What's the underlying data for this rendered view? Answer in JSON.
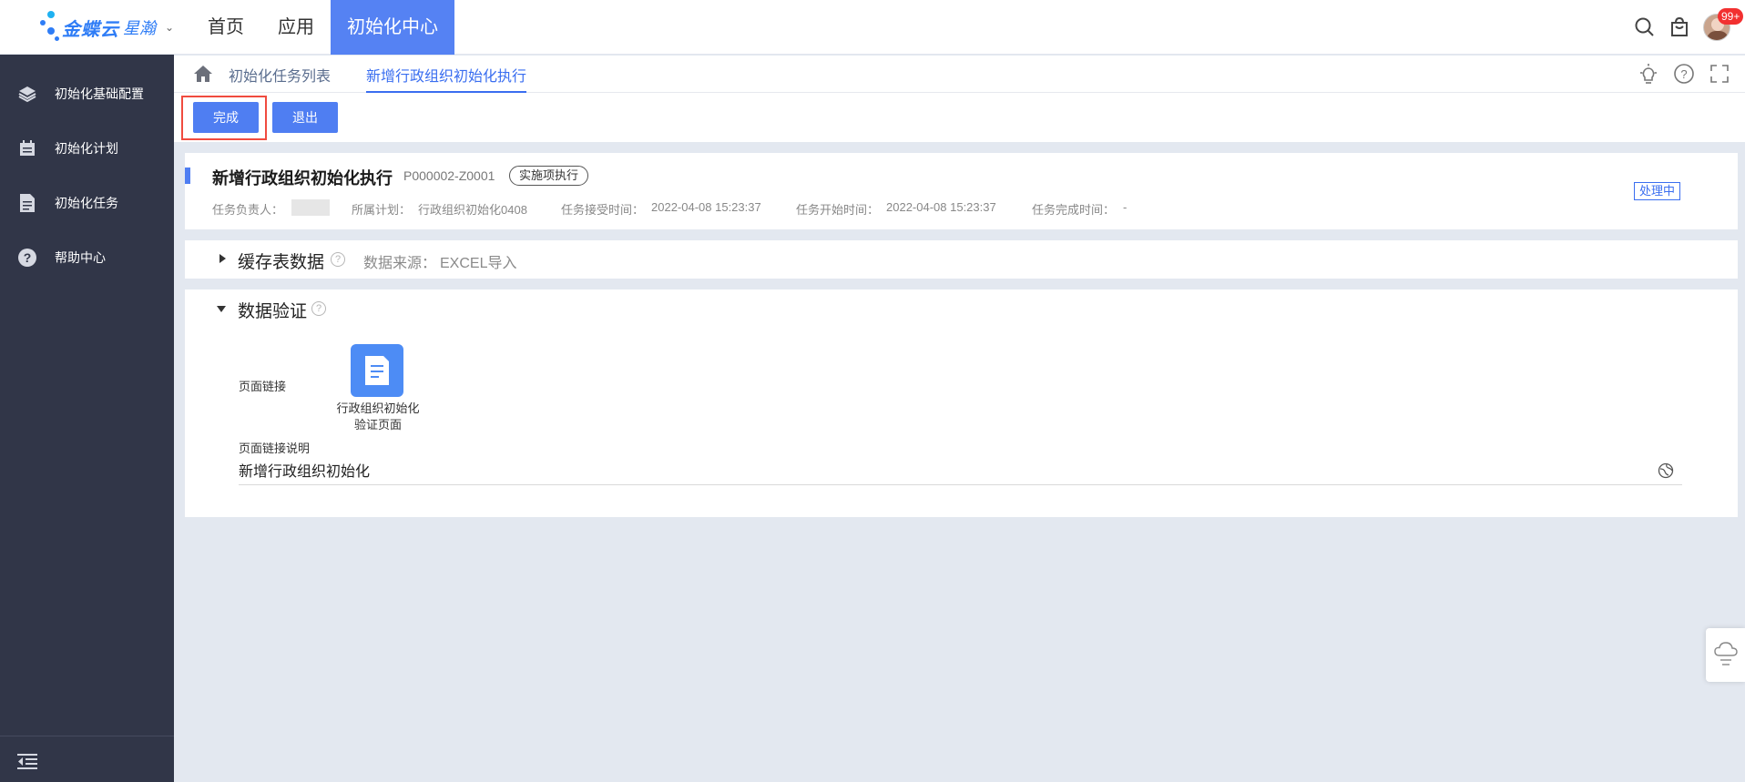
{
  "header": {
    "logo_text": "金蝶云",
    "logo_sub": "星瀚",
    "nav": [
      "首页",
      "应用",
      "初始化中心"
    ],
    "badge": "99+",
    "colors": {
      "accent": "#5582f3",
      "sidebar": "#313648",
      "badge": "#f23030"
    }
  },
  "sidebar": {
    "items": [
      {
        "label": "初始化基础配置",
        "icon": "layers-icon"
      },
      {
        "label": "初始化计划",
        "icon": "calendar-icon"
      },
      {
        "label": "初始化任务",
        "icon": "document-icon"
      },
      {
        "label": "帮助中心",
        "icon": "help-icon"
      }
    ]
  },
  "breadcrumb": {
    "items": [
      "初始化任务列表",
      "新增行政组织初始化执行"
    ]
  },
  "toolbar": {
    "complete_label": "完成",
    "exit_label": "退出"
  },
  "task": {
    "title": "新增行政组织初始化执行",
    "code": "P000002-Z0001",
    "tag": "实施项执行",
    "owner_label": "任务负责人：",
    "plan_label": "所属计划：",
    "plan_value": "行政组织初始化0408",
    "accept_label": "任务接受时间：",
    "accept_value": "2022-04-08 15:23:37",
    "start_label": "任务开始时间：",
    "start_value": "2022-04-08 15:23:37",
    "finish_label": "任务完成时间：",
    "finish_value": "-",
    "status": "处理中"
  },
  "cache_section": {
    "title": "缓存表数据",
    "source_label": "数据来源：",
    "source_value": "EXCEL导入"
  },
  "validation_section": {
    "title": "数据验证",
    "page_link_label": "页面链接",
    "page_link_caption_line1": "行政组织初始化",
    "page_link_caption_line2": "验证页面",
    "desc_label": "页面链接说明",
    "desc_value": "新增行政组织初始化"
  }
}
